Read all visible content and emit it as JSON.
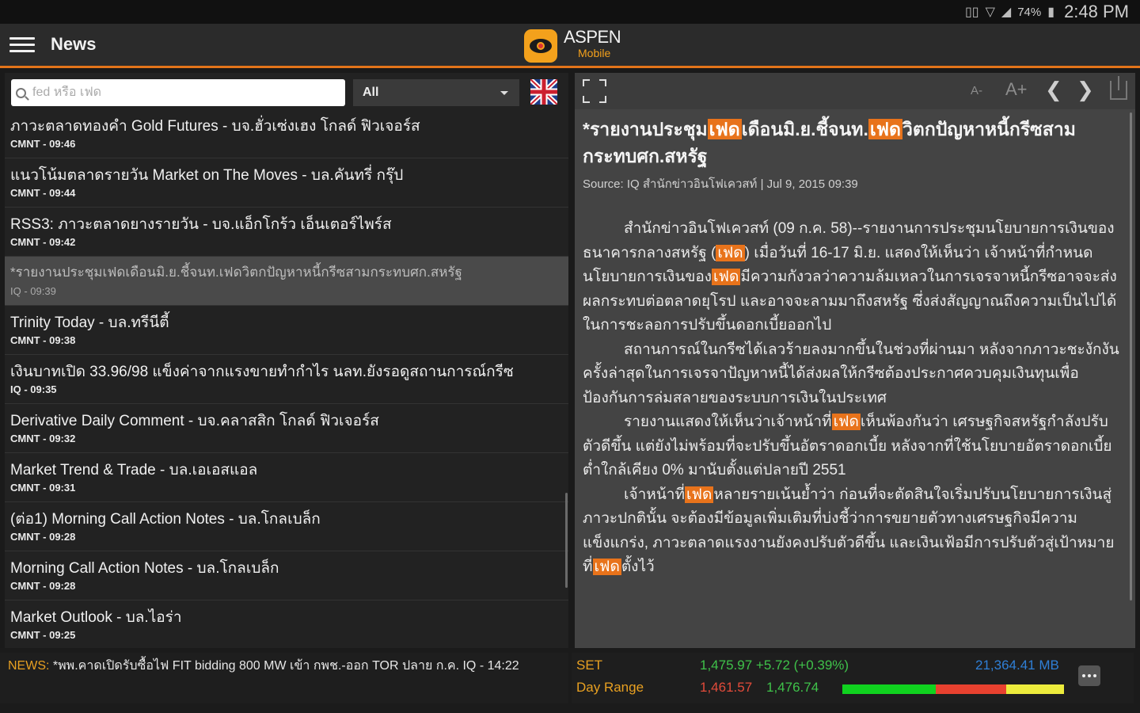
{
  "statusbar": {
    "battery": "74%",
    "time": "2:48 PM"
  },
  "appbar": {
    "title": "News",
    "brand_name": "ASPEN",
    "brand_sub": "Mobile"
  },
  "search": {
    "placeholder": "fed หรือ เฟด"
  },
  "filter": {
    "selected": "All"
  },
  "news": [
    {
      "title": "ภาวะตลาดทองคำ Gold Futures - บจ.ฮั่วเซ่งเฮง โกลด์ ฟิวเจอร์ส",
      "meta": "CMNT - 09:46"
    },
    {
      "title": "แนวโน้มตลาดรายวัน Market on The Moves - บล.คันทรี่ กรุ๊ป",
      "meta": "CMNT - 09:44"
    },
    {
      "title": "RSS3: ภาวะตลาดยางรายวัน - บจ.แอ็กโกร้ว เอ็นเตอร์ไพร์ส",
      "meta": "CMNT - 09:42"
    },
    {
      "title": "*รายงานประชุมเฟดเดือนมิ.ย.ชี้จนท.เฟดวิตกปัญหาหนี้กรีซสามกระทบศก.สหรัฐ",
      "meta": "IQ - 09:39",
      "selected": true
    },
    {
      "title": "Trinity Today - บล.ทรีนีตี้",
      "meta": "CMNT - 09:38"
    },
    {
      "title": "เงินบาทเปิด 33.96/98 แข็งค่าจากแรงขายทำกำไร นลท.ยังรอดูสถานการณ์กรีซ",
      "meta": "IQ - 09:35"
    },
    {
      "title": "Derivative Daily Comment - บจ.คลาสสิก โกลด์ ฟิวเจอร์ส",
      "meta": "CMNT - 09:32"
    },
    {
      "title": "Market Trend & Trade - บล.เอเอสแอล",
      "meta": "CMNT - 09:31"
    },
    {
      "title": "(ต่อ1) Morning Call Action Notes - บล.โกลเบล็ก",
      "meta": "CMNT - 09:28"
    },
    {
      "title": "Morning Call Action Notes - บล.โกลเบล็ก",
      "meta": "CMNT - 09:28"
    },
    {
      "title": "Market Outlook - บล.ไอร่า",
      "meta": "CMNT - 09:25"
    }
  ],
  "article": {
    "headline_parts": [
      "*รายงานประชุม",
      "เฟด",
      "เดือนมิ.ย.ชี้จนท.",
      "เฟด",
      "วิตกปัญหาหนี้กรีซสามกระทบศก.สหรัฐ"
    ],
    "source": "Source: IQ สำนักข่าวอินโฟเควสท์ | Jul 9, 2015 09:39",
    "p1": [
      "สำนักข่าวอินโฟเควสท์ (09 ก.ค. 58)--รายงานการประชุมนโยบายการเงินของธนาคารกลางสหรัฐ (",
      "เฟด",
      ") เมื่อวันที่ 16-17 มิ.ย. แสดงให้เห็นว่า เจ้าหน้าที่กำหนดนโยบายการเงินของ",
      "เฟด",
      "มีความกังวลว่าความล้มเหลวในการเจรจาหนี้กรีซอาจจะส่งผลกระทบต่อตลาดยุโรป และอาจจะลามมาถึงสหรัฐ ซึ่งส่งสัญญาณถึงความเป็นไปได้ในการชะลอการปรับขึ้นดอกเบี้ยออกไป"
    ],
    "p2": "สถานการณ์ในกรีซได้เลวร้ายลงมากขึ้นในช่วงที่ผ่านมา หลังจากภาวะชะงักงันครั้งล่าสุดในการเจรจาปัญหาหนี้ได้ส่งผลให้กรีซต้องประกาศควบคุมเงินทุนเพื่อป้องกันการล่มสลายของระบบการเงินในประเทศ",
    "p3": [
      "รายงานแสดงให้เห็นว่าเจ้าหน้าที่",
      "เฟด",
      "เห็นพ้องกันว่า เศรษฐกิจสหรัฐกำลังปรับตัวดีขึ้น แต่ยังไม่พร้อมที่จะปรับขึ้นอัตราดอกเบี้ย หลังจากที่ใช้นโยบายอัตราดอกเบี้ยต่ำใกล้เคียง 0% มานับตั้งแต่ปลายปี 2551"
    ],
    "p4": [
      "เจ้าหน้าที่",
      "เฟด",
      "หลายรายเน้นย้ำว่า ก่อนที่จะตัดสินใจเริ่มปรับนโยบายการเงินสู่ภาวะปกตินั้น จะต้องมีข้อมูลเพิ่มเติมที่บ่งชี้ว่าการขยายตัวทางเศรษฐกิจมีความแข็งแกร่ง, ภาวะตลาดแรงงานยังคงปรับตัวดีขึ้น และเงินเฟ้อมีการปรับตัวสู่เป้าหมายที่",
      "เฟด",
      "ตั้งไว้"
    ],
    "font_decrease": "A-",
    "font_increase": "A+"
  },
  "ticker": {
    "label": "NEWS:",
    "text": " *พพ.คาดเปิดรับซื้อไฟ FIT bidding 800 MW เข้า กพช.-ออก TOR ปลาย ก.ค. IQ - 14:22"
  },
  "market": {
    "index_name": "SET",
    "index_value": "1,475.97 +5.72 (+0.39%)",
    "volume": "21,364.41 MB",
    "range_label": "Day Range",
    "range_low": "1,461.57",
    "range_high": "1,476.74"
  }
}
